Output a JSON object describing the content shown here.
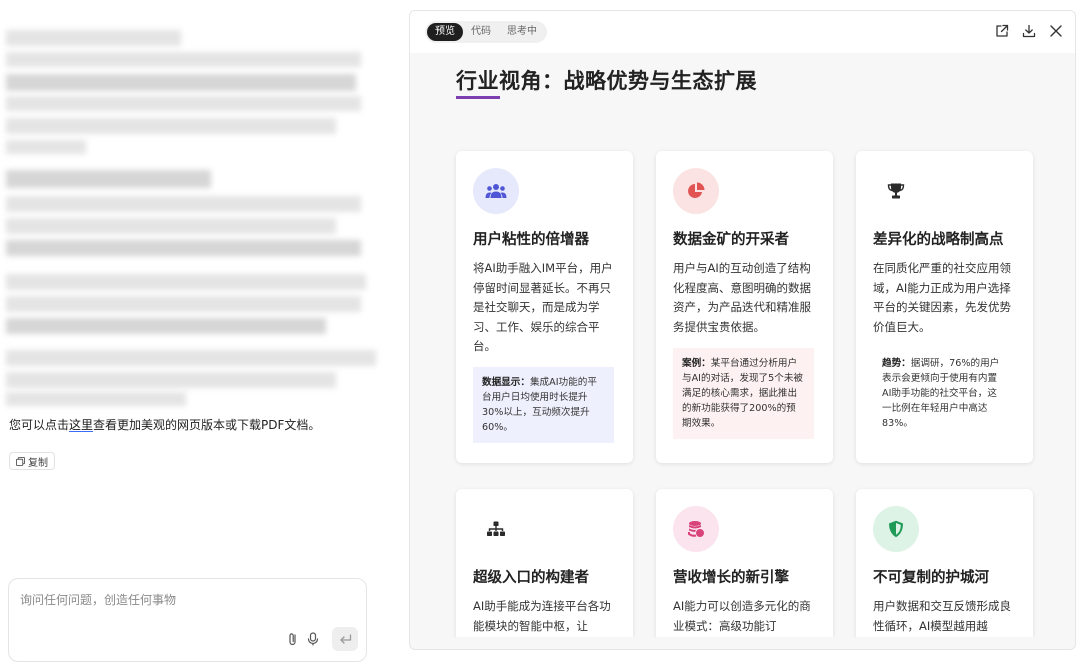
{
  "chat": {
    "note_prefix": "您可以点击",
    "note_link": "这里",
    "note_suffix": "查看更加美观的网页版本或下载PDF文档。",
    "copy_label": "复制",
    "composer_placeholder": "询问任何问题，创造任何事物"
  },
  "preview": {
    "tabs": [
      {
        "label": "预览",
        "active": true
      },
      {
        "label": "代码",
        "active": false
      },
      {
        "label": "思考中",
        "active": false
      }
    ],
    "top_icons": [
      "open-external-icon",
      "download-icon",
      "close-icon"
    ],
    "page_title": "行业视角：战略优势与生态扩展",
    "accent_color": "#7b3fb0",
    "cards": [
      {
        "icon": "users-icon",
        "icon_bg": "#e6e8fb",
        "icon_color": "#4f56d6",
        "title": "用户粘性的倍增器",
        "body": "将AI助手融入IM平台，用户停留时间显著延长。不再只是社交聊天，而是成为学习、工作、娱乐的综合平台。",
        "note_label": "数据显示：",
        "note_text": "集成AI功能的平台用户日均使用时长提升30%以上，互动频次提升60%。",
        "note_bg": "#eef1fd"
      },
      {
        "icon": "pie-chart-icon",
        "icon_bg": "#fbe3e3",
        "icon_color": "#e05454",
        "title": "数据金矿的开采者",
        "body": "用户与AI的互动创造了结构化程度高、意图明确的数据资产，为产品迭代和精准服务提供宝贵依据。",
        "note_label": "案例：",
        "note_text": "某平台通过分析用户与AI的对话，发现了5个未被满足的核心需求，据此推出的新功能获得了200%的预期效果。",
        "note_bg": "#fdf1f1"
      },
      {
        "icon": "trophy-icon",
        "icon_bg": "#ffffff",
        "icon_color": "#2b2b2b",
        "title": "差异化的战略制高点",
        "body": "在同质化严重的社交应用领域，AI能力正成为用户选择平台的关键因素，先发优势价值巨大。",
        "note_label": "趋势：",
        "note_text": "据调研，76%的用户表示会更倾向于使用有内置AI助手功能的社交平台，这一比例在年轻用户中高达83%。",
        "note_bg": "#ffffff"
      },
      {
        "icon": "sitemap-icon",
        "icon_bg": "#ffffff",
        "icon_color": "#2b2b2b",
        "title": "超级入口的构建者",
        "body": "AI助手能成为连接平台各功能模块的智能中枢，让"
      },
      {
        "icon": "coins-icon",
        "icon_bg": "#fbe4ee",
        "icon_color": "#d8437a",
        "title": "营收增长的新引擎",
        "body": "AI能力可以创造多元化的商业模式：高级功能订"
      },
      {
        "icon": "shield-icon",
        "icon_bg": "#ddf3e6",
        "icon_color": "#1f9a57",
        "title": "不可复制的护城河",
        "body": "用户数据和交互反馈形成良性循环，AI模型越用越"
      }
    ]
  }
}
